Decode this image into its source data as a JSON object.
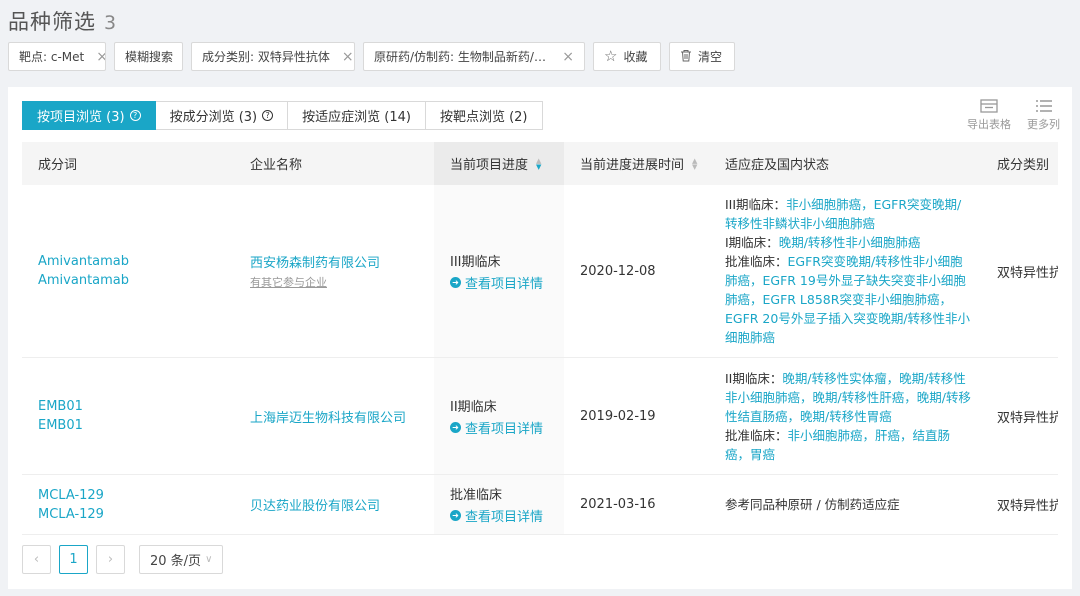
{
  "header": {
    "title": "品种筛选",
    "count": "3"
  },
  "filters": [
    {
      "label": "靶点: c-Met"
    },
    {
      "label": "模糊搜索"
    },
    {
      "label": "成分类别: 双特异性抗体"
    },
    {
      "label": "原研药/仿制药: 生物制品新药/原..."
    }
  ],
  "actions": {
    "collect": "收藏",
    "clear": "清空"
  },
  "tabs": [
    {
      "label": "按项目浏览 (3)"
    },
    {
      "label": "按成分浏览 (3)"
    },
    {
      "label": "按适应症浏览 (14)"
    },
    {
      "label": "按靶点浏览 (2)"
    }
  ],
  "tools": {
    "export": "导出表格",
    "more_columns": "更多列"
  },
  "table": {
    "headers": [
      "成分词",
      "企业名称",
      "当前项目进度",
      "当前进度进展时间",
      "适应症及国内状态",
      "成分类别"
    ],
    "rows": [
      {
        "ingredient1": "Amivantamab",
        "ingredient2": "Amivantamab",
        "company": "西安杨森制药有限公司",
        "company_sub": "有其它参与企业",
        "progress": "III期临床",
        "detail": "查看项目详情",
        "date": "2020-12-08",
        "ind": [
          {
            "prefix": "III期临床：",
            "text": "非小细胞肺癌，EGFR突变晚期/转移性非鳞状非小细胞肺癌"
          },
          {
            "prefix": "I期临床：",
            "text": "晚期/转移性非小细胞肺癌"
          },
          {
            "prefix": "批准临床：",
            "text": "EGFR突变晚期/转移性非小细胞肺癌，EGFR 19号外显子缺失突变非小细胞肺癌，EGFR L858R突变非小细胞肺癌，EGFR 20号外显子插入突变晚期/转移性非小细胞肺癌"
          }
        ],
        "category": "双特异性抗体"
      },
      {
        "ingredient1": "EMB01",
        "ingredient2": "EMB01",
        "company": "上海岸迈生物科技有限公司",
        "progress": "II期临床",
        "detail": "查看项目详情",
        "date": "2019-02-19",
        "ind": [
          {
            "prefix": "II期临床：",
            "text": "晚期/转移性实体瘤，晚期/转移性非小细胞肺癌，晚期/转移性肝癌，晚期/转移性结直肠癌，晚期/转移性胃癌"
          },
          {
            "prefix": "批准临床：",
            "text": "非小细胞肺癌，肝癌，结直肠癌，胃癌"
          }
        ],
        "category": "双特异性抗体"
      },
      {
        "ingredient1": "MCLA-129",
        "ingredient2": "MCLA-129",
        "company": "贝达药业股份有限公司",
        "progress": "批准临床",
        "detail": "查看项目详情",
        "date": "2021-03-16",
        "ind_plain": "参考同品种原研 / 仿制药适应症",
        "category": "双特异性抗体"
      }
    ]
  },
  "pagination": {
    "current": "1",
    "page_size": "20 条/页"
  },
  "colors": {
    "accent": "#1aa6c7"
  }
}
